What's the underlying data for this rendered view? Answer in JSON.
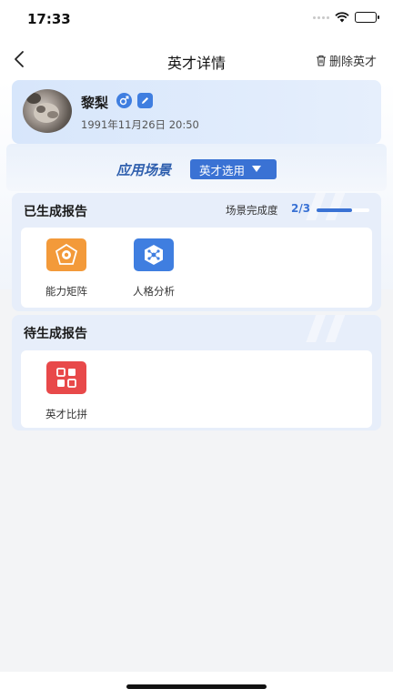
{
  "status_bar": {
    "time": "17:33"
  },
  "nav": {
    "title": "英才详情",
    "delete_label": "删除英才"
  },
  "profile": {
    "name": "黎梨",
    "datetime": "1991年11月26日 20:50"
  },
  "scene": {
    "label": "应用场景",
    "selected": "英才选用"
  },
  "generated": {
    "title": "已生成报告",
    "progress_label": "场景完成度",
    "progress_value": "2/3",
    "progress_fraction": 0.667,
    "items": [
      {
        "label": "能力矩阵",
        "icon": "ability-matrix-icon",
        "color": "#f39a3a"
      },
      {
        "label": "人格分析",
        "icon": "personality-analysis-icon",
        "color": "#3f7ee0"
      }
    ]
  },
  "pending": {
    "title": "待生成报告",
    "items": [
      {
        "label": "英才比拼",
        "icon": "talent-compare-icon",
        "color": "#e8494a"
      }
    ]
  }
}
